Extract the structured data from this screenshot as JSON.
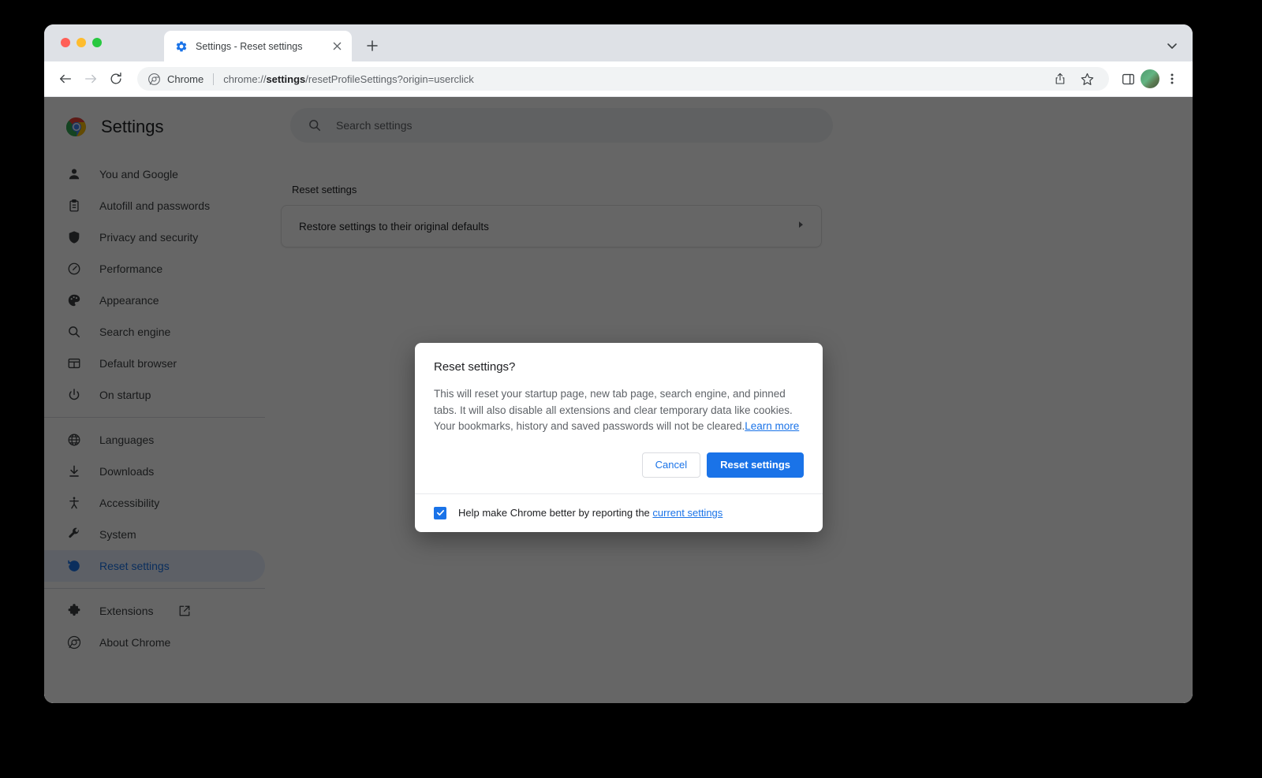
{
  "window": {
    "traffic_lights": [
      "close",
      "minimize",
      "maximize"
    ],
    "colors": {
      "accent": "#1a73e8",
      "tabstrip_bg": "#dee1e6",
      "selected_nav_bg": "#e8f0fe",
      "scrim": "rgba(0,0,0,0.60)"
    }
  },
  "tabstrip": {
    "tab": {
      "favicon": "gear-icon",
      "title": "Settings - Reset settings",
      "close_label": "×"
    },
    "new_tab_label": "+",
    "chevron_icon": "chevron-down-icon"
  },
  "toolbar": {
    "back_icon": "back-arrow-icon",
    "forward_icon": "forward-arrow-icon",
    "reload_icon": "reload-icon",
    "omnibox": {
      "site_icon": "chrome-icon",
      "site_label": "Chrome",
      "url_prefix": "chrome://",
      "url_bold": "settings",
      "url_suffix": "/resetProfileSettings?origin=userclick",
      "full_url": "chrome://settings/resetProfileSettings?origin=userclick"
    },
    "share_icon": "share-icon",
    "bookmark_icon": "star-icon",
    "side_panel_icon": "side-panel-icon",
    "avatar_icon": "avatar",
    "menu_icon": "three-dot-menu-icon"
  },
  "sidebar": {
    "brand": {
      "logo": "chrome-logo-icon",
      "title": "Settings"
    },
    "items": [
      {
        "label": "You and Google",
        "icon": "person-icon",
        "selected": false
      },
      {
        "label": "Autofill and passwords",
        "icon": "clipboard-icon",
        "selected": false
      },
      {
        "label": "Privacy and security",
        "icon": "shield-icon",
        "selected": false
      },
      {
        "label": "Performance",
        "icon": "speedometer-icon",
        "selected": false
      },
      {
        "label": "Appearance",
        "icon": "palette-icon",
        "selected": false
      },
      {
        "label": "Search engine",
        "icon": "search-icon",
        "selected": false
      },
      {
        "label": "Default browser",
        "icon": "browser-window-icon",
        "selected": false
      },
      {
        "label": "On startup",
        "icon": "power-icon",
        "selected": false
      }
    ],
    "items2": [
      {
        "label": "Languages",
        "icon": "globe-icon",
        "selected": false
      },
      {
        "label": "Downloads",
        "icon": "download-icon",
        "selected": false
      },
      {
        "label": "Accessibility",
        "icon": "accessibility-icon",
        "selected": false
      },
      {
        "label": "System",
        "icon": "wrench-icon",
        "selected": false
      },
      {
        "label": "Reset settings",
        "icon": "history-clock-icon",
        "selected": true
      }
    ],
    "items3": [
      {
        "label": "Extensions",
        "icon": "puzzle-icon",
        "external": true
      },
      {
        "label": "About Chrome",
        "icon": "chrome-outline-icon",
        "external": false
      }
    ]
  },
  "main": {
    "search": {
      "icon": "search-icon",
      "placeholder": "Search settings",
      "value": ""
    },
    "section_title": "Reset settings",
    "card": {
      "label": "Restore settings to their original defaults",
      "arrow_icon": "chevron-right-icon"
    }
  },
  "dialog": {
    "title": "Reset settings?",
    "body_text": "This will reset your startup page, new tab page, search engine, and pinned tabs. It will also disable all extensions and clear temporary data like cookies. Your bookmarks, history and saved passwords will not be cleared.",
    "body_link": "Learn more",
    "cancel_label": "Cancel",
    "confirm_label": "Reset settings",
    "footer": {
      "checkbox_checked": true,
      "text": "Help make Chrome better by reporting the ",
      "link": "current settings"
    }
  }
}
